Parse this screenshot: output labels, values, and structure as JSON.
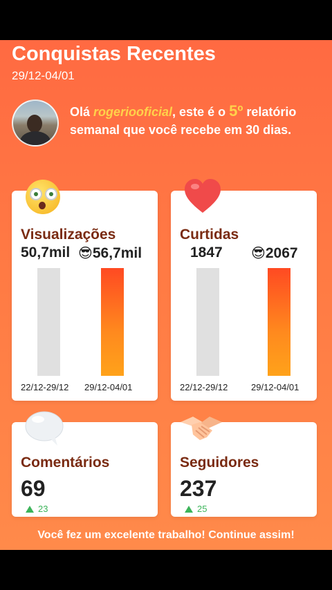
{
  "header": {
    "title": "Conquistas Recentes",
    "date_range": "29/12-04/01"
  },
  "greeting": {
    "prefix": "Olá ",
    "username": "rogeriooficial",
    "middle": ", este é o ",
    "number": "5º",
    "suffix": " relatório semanal que você recebe em 30 dias."
  },
  "cards": {
    "views": {
      "title": "Visualizações",
      "previous": "50,7mil",
      "current": "56,7mil",
      "prev_label": "22/12-29/12",
      "cur_label": "29/12-04/01"
    },
    "likes": {
      "title": "Curtidas",
      "previous": "1847",
      "current": "2067",
      "prev_label": "22/12-29/12",
      "cur_label": "29/12-04/01"
    },
    "comments": {
      "title": "Comentários",
      "value": "69",
      "delta": "23"
    },
    "followers": {
      "title": "Seguidores",
      "value": "237",
      "delta": "25"
    }
  },
  "footer": "Você fez um excelente trabalho! Continue assim!",
  "colors": {
    "accent": "#ff6a42",
    "title_brown": "#7a2b12",
    "highlight_yellow": "#ffd24a",
    "positive_green": "#3cb45a"
  },
  "icons": {
    "views": "surprised-face-icon",
    "likes": "heart-icon",
    "comments": "speech-bubble-icon",
    "followers": "handshake-icon",
    "cool": "sunglasses-face-icon"
  }
}
